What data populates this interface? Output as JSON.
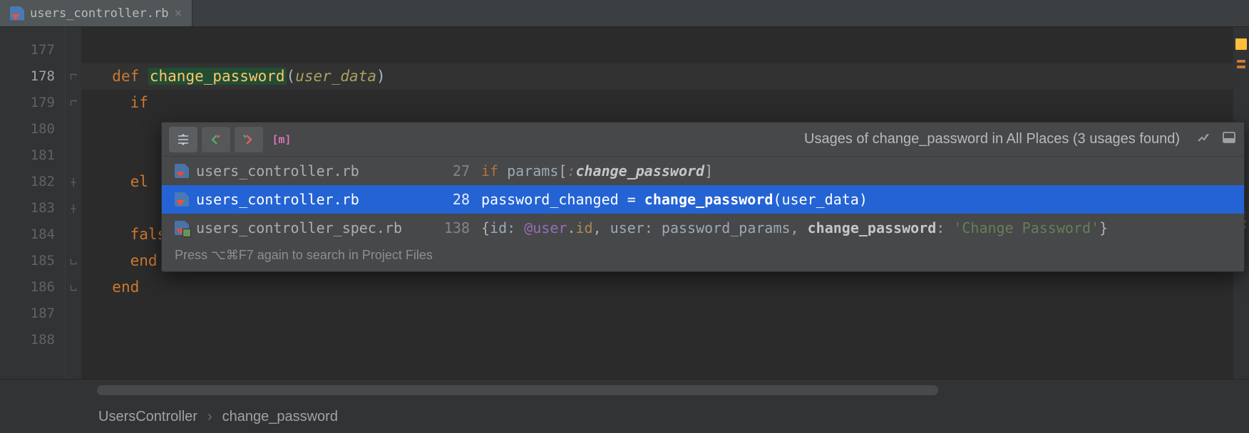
{
  "tab": {
    "filename": "users_controller.rb"
  },
  "gutter": {
    "lines": [
      "177",
      "178",
      "179",
      "180",
      "181",
      "182",
      "183",
      "184",
      "185",
      "186",
      "187",
      "188"
    ],
    "current": "178"
  },
  "code": {
    "l178": {
      "def": "def ",
      "fn": "change_password",
      "po": "(",
      "param": "user_data",
      "pc": ")"
    },
    "l179": {
      "if": "if"
    },
    "l182": {
      "else": "el"
    },
    "l184": {
      "false": "false"
    },
    "l185": {
      "end": "end"
    },
    "l186": {
      "end": "end"
    }
  },
  "popup": {
    "title": "Usages of change_password in All Places (3 usages found)",
    "footer": "Press ⌥⌘F7 again to search in Project Files",
    "rows": [
      {
        "file": "users_controller.rb",
        "line": "27",
        "selected": false,
        "spec": false,
        "snippet_parts": [
          {
            "t": "if ",
            "c": "kw2"
          },
          {
            "t": "params",
            "c": "ident2"
          },
          {
            "t": "[",
            "c": ""
          },
          {
            "t": ":",
            "c": "sym"
          },
          {
            "t": "change_password",
            "c": "b sym"
          },
          {
            "t": "]",
            "c": ""
          }
        ]
      },
      {
        "file": "users_controller.rb",
        "line": "28",
        "selected": true,
        "spec": false,
        "snippet_parts": [
          {
            "t": "password_changed = ",
            "c": ""
          },
          {
            "t": "change_password",
            "c": "b"
          },
          {
            "t": "(user_data)",
            "c": ""
          }
        ]
      },
      {
        "file": "users_controller_spec.rb",
        "line": "138",
        "selected": false,
        "spec": true,
        "snippet_parts": [
          {
            "t": "{",
            "c": ""
          },
          {
            "t": "id: ",
            "c": "ident2"
          },
          {
            "t": "@user",
            "c": "ivar"
          },
          {
            "t": ".",
            "c": ""
          },
          {
            "t": "id",
            "c": "meth"
          },
          {
            "t": ", ",
            "c": ""
          },
          {
            "t": "user: ",
            "c": "ident2"
          },
          {
            "t": "password_params, ",
            "c": "ident2"
          },
          {
            "t": "change_password",
            "c": "b"
          },
          {
            "t": ": ",
            "c": "ident2"
          },
          {
            "t": "'Change Password'",
            "c": "str"
          },
          {
            "t": "}",
            "c": ""
          }
        ]
      }
    ]
  },
  "breadcrumb": {
    "a": "UsersController",
    "b": "change_password"
  }
}
